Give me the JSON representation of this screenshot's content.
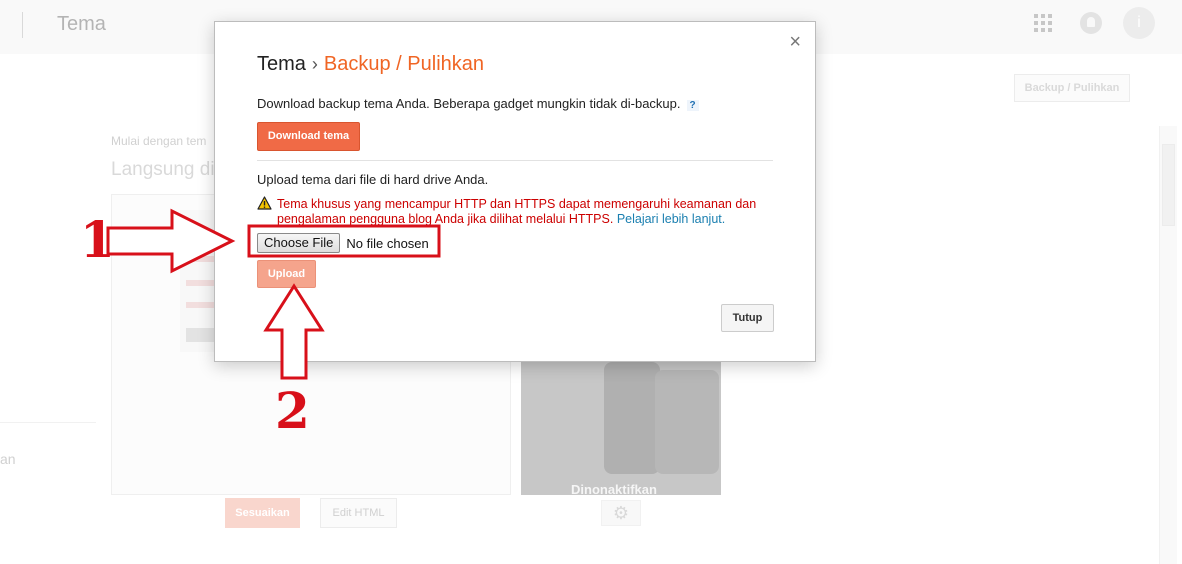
{
  "topbar": {
    "title": "Tema",
    "avatar_letter": "i"
  },
  "background": {
    "backup_button": "Backup / Pulihkan",
    "mulai_text": "Mulai dengan tem",
    "langsung_text": "Langsung di",
    "left_fragment": "an",
    "disabled_caption": "Dinonaktifkan",
    "sesuaikan_button": "Sesuaikan",
    "edit_html_button": "Edit HTML"
  },
  "dialog": {
    "breadcrumb_root": "Tema",
    "breadcrumb_separator": "›",
    "breadcrumb_current": "Backup / Pulihkan",
    "close": "×",
    "download_text": "Download backup tema Anda. Beberapa gadget mungkin tidak di-backup.",
    "help": "?",
    "download_button": "Download tema",
    "upload_text": "Upload tema dari file di hard drive Anda.",
    "warning_text": "Tema khusus yang mencampur HTTP dan HTTPS dapat memengaruhi keamanan dan pengalaman pengguna blog Anda jika dilihat melalui HTTPS.",
    "warning_link": "Pelajari lebih lanjut.",
    "choose_file_button": "Choose File",
    "file_status": "No file chosen",
    "upload_button": "Upload",
    "close_button": "Tutup"
  },
  "annotations": {
    "step1": "1",
    "step2": "2",
    "color": "#d8101a"
  },
  "colors": {
    "accent": "#f06524",
    "primary_button": "#f06a46",
    "warning": "#cc0000",
    "link": "#1a7fb0"
  }
}
